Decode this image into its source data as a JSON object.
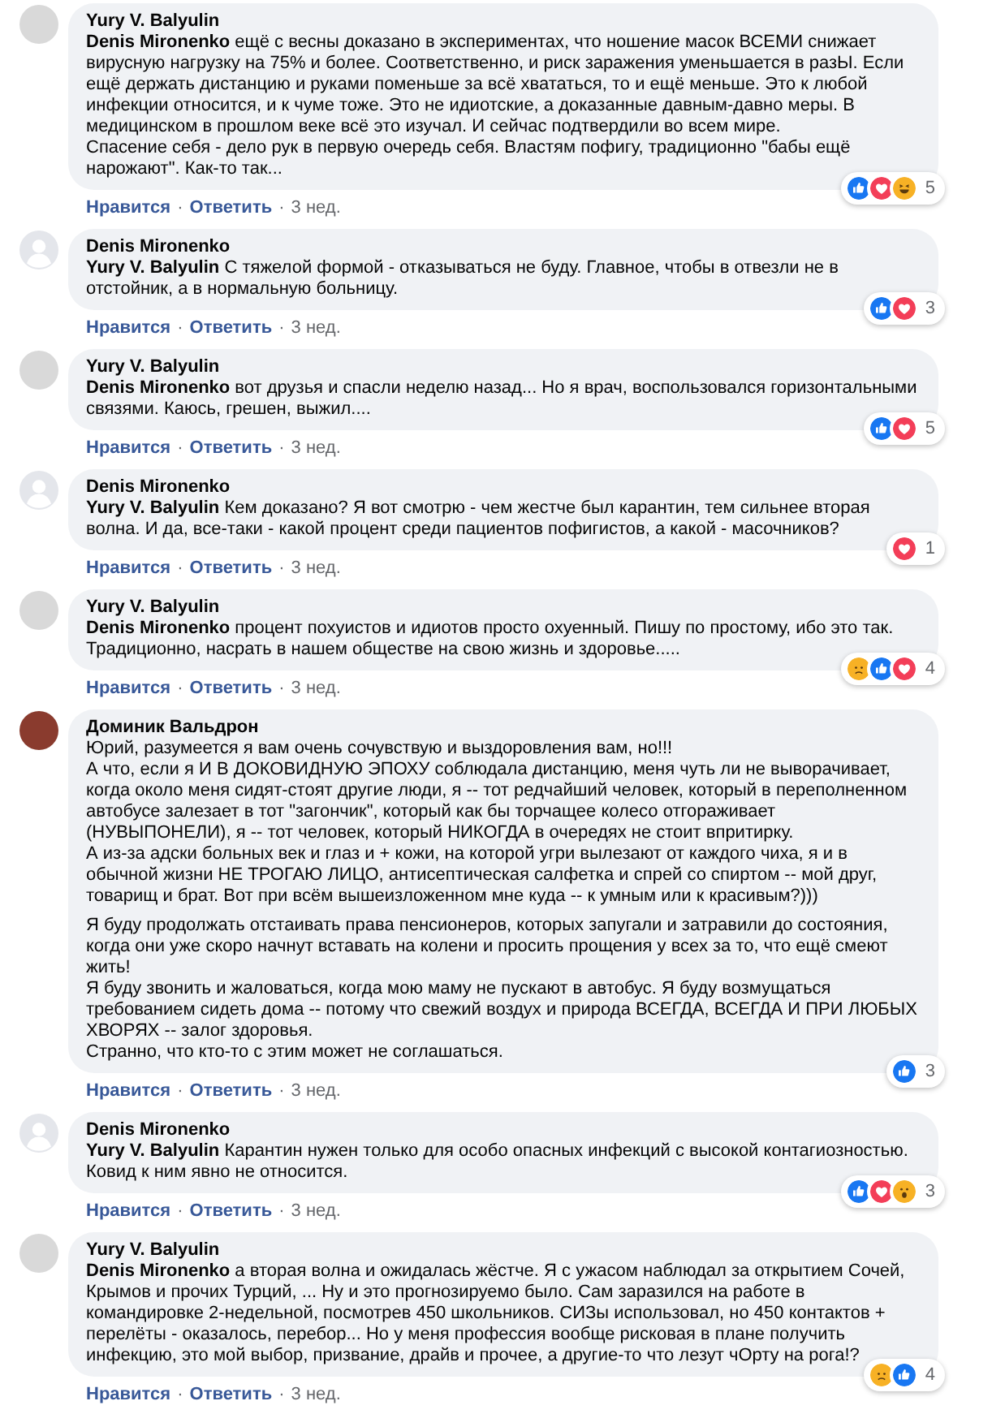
{
  "separator": "·",
  "comments": [
    {
      "author": "Yury V. Balyulin",
      "avatar": {
        "kind": "photo"
      },
      "blocks": [
        [
          "**Denis Mironenko** ещё с весны доказано в экспериментах, что ношение масок ВСЕМИ снижает вирусную нагрузку на 75% и более. Соответственно, и риск заражения уменьшается в разЫ. Если ещё держать дистанцию и руками поменьше за всё хвататься, то и ещё меньше. Это к любой инфекции относится, и к чуме тоже. Это не идиотские, а доказанные давным-давно меры. В медицинском в прошлом веке всё это изучал. И сейчас подтвердили во всем мире.",
          "Спасение себя - дело рук в первую очередь себя. Властям пофигу, традиционно \"бабы ещё нарожают\". Как-то так..."
        ]
      ],
      "reactions": [
        {
          "kind": "like"
        },
        {
          "kind": "love"
        },
        {
          "kind": "haha"
        }
      ],
      "reaction_count": "5",
      "actions": [
        "Нравится",
        "Ответить"
      ],
      "time": "3 нед."
    },
    {
      "author": "Denis Mironenko",
      "avatar": {
        "kind": "default"
      },
      "blocks": [
        [
          "**Yury V. Balyulin** С тяжелой формой - отказываться не буду. Главное, чтобы в отвезли не в отстойник, а в нормальную больницу."
        ]
      ],
      "reactions": [
        {
          "kind": "like"
        },
        {
          "kind": "love"
        }
      ],
      "reaction_count": "3",
      "actions": [
        "Нравится",
        "Ответить"
      ],
      "time": "3 нед."
    },
    {
      "author": "Yury V. Balyulin",
      "avatar": {
        "kind": "photo"
      },
      "blocks": [
        [
          "**Denis Mironenko** вот друзья и спасли неделю назад... Но я врач, воспользовался горизонтальными связями. Каюсь, грешен, выжил...."
        ]
      ],
      "reactions": [
        {
          "kind": "like"
        },
        {
          "kind": "love"
        }
      ],
      "reaction_count": "5",
      "actions": [
        "Нравится",
        "Ответить"
      ],
      "time": "3 нед."
    },
    {
      "author": "Denis Mironenko",
      "avatar": {
        "kind": "default"
      },
      "blocks": [
        [
          "**Yury V. Balyulin** Кем доказано? Я вот смотрю - чем жестче был карантин, тем сильнее вторая волна. И да, все-таки - какой процент среди пациентов пофигистов, а какой - масочников?"
        ]
      ],
      "reactions": [
        {
          "kind": "love"
        }
      ],
      "reaction_count": "1",
      "actions": [
        "Нравится",
        "Ответить"
      ],
      "time": "3 нед."
    },
    {
      "author": "Yury V. Balyulin",
      "avatar": {
        "kind": "photo"
      },
      "blocks": [
        [
          "**Denis Mironenko** процент похуистов и идиотов просто охуенный. Пишу по простому, ибо это так. Традиционно, насрать в нашем обществе на свою жизнь и здоровье....."
        ]
      ],
      "reactions": [
        {
          "kind": "sad"
        },
        {
          "kind": "like"
        },
        {
          "kind": "love"
        }
      ],
      "reaction_count": "4",
      "actions": [
        "Нравится",
        "Ответить"
      ],
      "time": "3 нед."
    },
    {
      "author": "Доминик Вальдрон",
      "avatar": {
        "kind": "photo_red"
      },
      "blocks": [
        [
          "Юрий, разумеется я вам очень сочувствую и выздоровления вам, но!!!",
          "А что, если я И В ДОКОВИДНУЮ ЭПОХУ соблюдала дистанцию, меня чуть ли не выворачивает, когда около меня сидят-стоят другие люди, я -- тот редчайший человек, который в переполненном автобусе залезает в тот \"загончик\", который как бы торчащее колесо отгораживает (НУВЫПОНЕЛИ), я -- тот человек, который НИКОГДА в очередях не стоит впритирку.",
          "А из-за адски больных век и глаз и + кожи, на которой угри вылезают от каждого чиха, я и в обычной жизни НЕ ТРОГАЮ ЛИЦО, антисептическая салфетка и спрей со спиртом -- мой друг, товарищ и брат. Вот при всём вышеизложенном мне куда -- к умным или к красивым?)))"
        ],
        [
          "Я буду продолжать отстаивать права пенсионеров, которых запугали и затравили до состояния, когда они уже скоро начнут вставать на колени и просить прощения у всех за то, что ещё смеют жить!",
          "Я буду звонить и жаловаться, когда мою маму не пускают в автобус. Я буду возмущаться требованием сидеть дома -- потому что свежий воздух и природа ВСЕГДА, ВСЕГДА И ПРИ ЛЮБЫХ ХВОРЯХ -- залог здоровья.",
          "Странно, что кто-то с этим может не соглашаться."
        ]
      ],
      "reactions": [
        {
          "kind": "like"
        }
      ],
      "reaction_count": "3",
      "actions": [
        "Нравится",
        "Ответить"
      ],
      "time": "3 нед."
    },
    {
      "author": "Denis Mironenko",
      "avatar": {
        "kind": "default"
      },
      "blocks": [
        [
          "**Yury V. Balyulin** Карантин нужен только для особо опасных инфекций с высокой контагиозностью. Ковид к ним явно не относится."
        ]
      ],
      "reactions": [
        {
          "kind": "like"
        },
        {
          "kind": "love"
        },
        {
          "kind": "wow"
        }
      ],
      "reaction_count": "3",
      "actions": [
        "Нравится",
        "Ответить"
      ],
      "time": "3 нед."
    },
    {
      "author": "Yury V. Balyulin",
      "avatar": {
        "kind": "photo"
      },
      "blocks": [
        [
          "**Denis Mironenko** а вторая волна и ожидалась жёстче. Я с ужасом наблюдал за открытием Сочей, Крымов и прочих Турций, ... Ну и это прогнозируемо было. Сам заразился на работе в командировке 2-недельной, посмотрев 450 школьников. СИЗы использовал, но 450 контактов + перелёты - оказалось, перебор... Но у меня профессия вообще рисковая в плане получить инфекцию, это мой выбор, призвание, драйв и прочее, а другие-то что лезут чОрту на рога!?"
        ]
      ],
      "reactions": [
        {
          "kind": "sad"
        },
        {
          "kind": "like"
        }
      ],
      "reaction_count": "4",
      "actions": [
        "Нравится",
        "Ответить"
      ],
      "time": "3 нед."
    }
  ]
}
